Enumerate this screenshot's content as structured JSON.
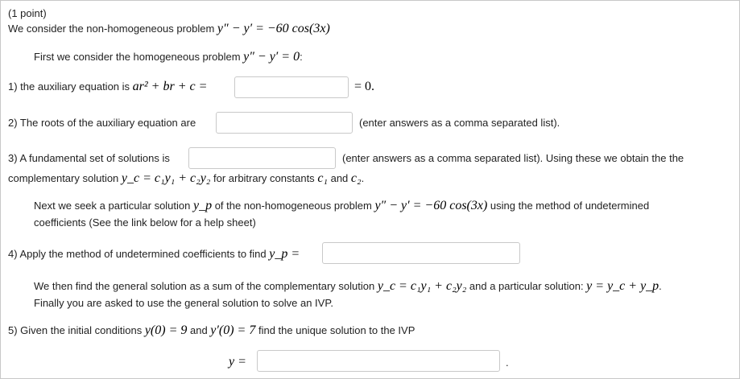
{
  "header": {
    "points": "(1 point)",
    "intro": "We consider the non-homogeneous problem ",
    "eq": "y″ − y′ = −60 cos(3x)"
  },
  "homog": {
    "text": "First we consider the homogeneous problem ",
    "eq": "y″ − y′ = 0",
    "end": ":"
  },
  "q1": {
    "text": "1) the auxiliary equation is ",
    "eq": "ar² + br + c =",
    "after": "= 0.",
    "value": ""
  },
  "q2": {
    "text": "2) The roots of the auxiliary equation are",
    "after": "(enter answers as a comma separated list).",
    "value": ""
  },
  "q3": {
    "text": "3) A fundamental set of solutions is",
    "after": "(enter answers as a comma separated list). Using these we obtain the the",
    "line2_a": "complementary solution ",
    "line2_eq": "y_c = c₁y₁ + c₂y₂",
    "line2_b": " for arbitrary constants ",
    "line2_c": "c₁",
    "line2_and": " and ",
    "line2_d": "c₂",
    "line2_end": ".",
    "value": ""
  },
  "next": {
    "text_a": "Next we seek a particular solution ",
    "yp": "y_p",
    "text_b": " of the non-homogeneous problem ",
    "eq": "y″ − y′ = −60 cos(3x)",
    "text_c": " using the method of undetermined",
    "line2": "coefficients (See the link below for a help sheet)"
  },
  "q4": {
    "text": "4) Apply the method of undetermined coefficients to find ",
    "yp": "y_p =",
    "value": ""
  },
  "general": {
    "text_a": "We then find the general solution as a sum of the complementary solution ",
    "eq1": "y_c = c₁y₁ + c₂y₂",
    "text_b": " and a particular solution: ",
    "eq2": "y = y_c + y_p",
    "end": ".",
    "line2": "Finally you are asked to use the general solution to solve an IVP."
  },
  "q5": {
    "text_a": "5) Given the initial conditions ",
    "c1": "y(0) = 9",
    "and": " and ",
    "c2": "y′(0) = 7",
    "text_b": " find the unique solution to the IVP",
    "y": "y =",
    "value": "",
    "end": "."
  }
}
